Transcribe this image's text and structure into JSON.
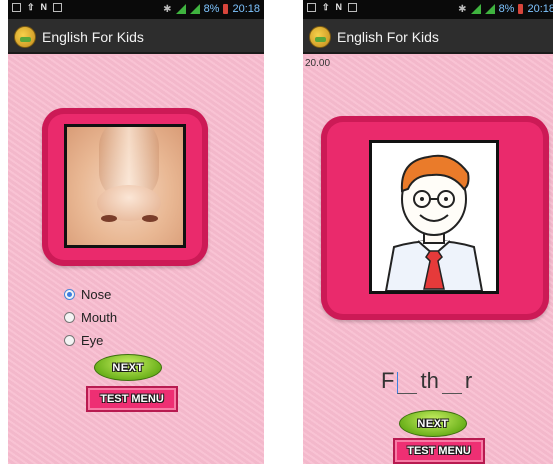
{
  "left_screen": {
    "status": {
      "battery_pct": "8%",
      "time": "20:18"
    },
    "app_title": "English For Kids",
    "options": [
      {
        "label": "Nose",
        "selected": true
      },
      {
        "label": "Mouth",
        "selected": false
      },
      {
        "label": "Eye",
        "selected": false
      }
    ],
    "next_label": "NEXT",
    "test_menu_label": "TEST MENU"
  },
  "right_screen": {
    "status": {
      "battery_pct": "8%",
      "time": "20:18"
    },
    "app_title": "English For Kids",
    "timer": "20.00",
    "word_parts": [
      "F",
      "th",
      "r"
    ],
    "next_label": "NEXT",
    "test_menu_label": "TEST MENU"
  },
  "colors": {
    "background_pink": "#f8bccf",
    "frame_magenta": "#ea2a6c",
    "next_green": "#6db21c",
    "action_bar": "#2d2d2d"
  },
  "icons": [
    "photo-icon",
    "wifi-icon",
    "notification-icon",
    "signal-icon",
    "battery-icon",
    "app-logo-icon",
    "nose-image",
    "father-image"
  ]
}
